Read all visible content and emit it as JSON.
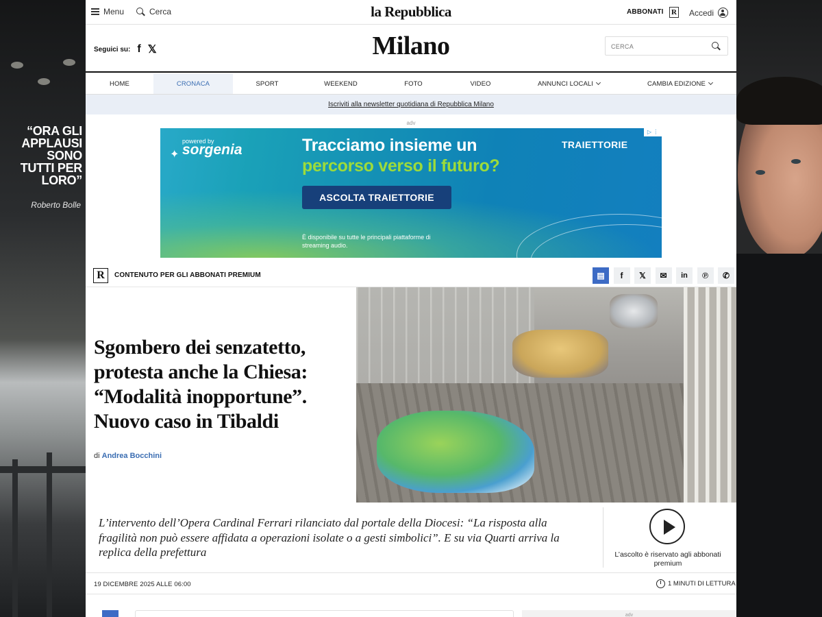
{
  "topbar": {
    "menu_label": "Menu",
    "search_label": "Cerca",
    "brand": "la Repubblica",
    "abbonati_label": "ABBONATI",
    "r_badge": "R",
    "accedi_label": "Accedi"
  },
  "masthead": {
    "follow_label": "Seguici su:",
    "facebook_glyph": "f",
    "x_glyph": "𝕏",
    "city": "Milano",
    "search_placeholder": "CERCA"
  },
  "nav": {
    "items": [
      {
        "label": "HOME",
        "active": false
      },
      {
        "label": "CRONACA",
        "active": true
      },
      {
        "label": "SPORT",
        "active": false
      },
      {
        "label": "WEEKEND",
        "active": false
      },
      {
        "label": "FOTO",
        "active": false
      },
      {
        "label": "VIDEO",
        "active": false
      },
      {
        "label": "ANNUNCI LOCALI",
        "active": false
      },
      {
        "label": "CAMBIA EDIZIONE",
        "active": false
      }
    ]
  },
  "newsletter": {
    "text": "Iscriviti alla newsletter quotidiana di Repubblica Milano"
  },
  "ad": {
    "label": "adv",
    "powered": "powered by",
    "brand": "sorgenia",
    "headline_1": "Tracciamo insieme un",
    "headline_2": "percorso verso il futuro?",
    "cta": "ASCOLTA TRAIETTORIE",
    "footnote": "È disponibile su tutte le principali piattaforme di streaming audio.",
    "sponsor": "TRAIETTORIE",
    "adchoices": "▷ ⋮"
  },
  "skin": {
    "quote": "“ORA GLI APPLAUSI SONO TUTTI PER LORO”",
    "signature": "Roberto Bolle"
  },
  "article": {
    "premium_badge": "R",
    "premium_label": "CONTENUTO PER GLI ABBONATI PREMIUM",
    "share_icons": [
      {
        "name": "comments-icon",
        "glyph": "▤"
      },
      {
        "name": "facebook-icon",
        "glyph": "f"
      },
      {
        "name": "x-icon",
        "glyph": "𝕏"
      },
      {
        "name": "email-icon",
        "glyph": "✉"
      },
      {
        "name": "linkedin-icon",
        "glyph": "in"
      },
      {
        "name": "pinterest-icon",
        "glyph": "℗"
      },
      {
        "name": "whatsapp-icon",
        "glyph": "✆"
      }
    ],
    "headline": "Sgombero dei senzatetto, protesta anche la Chiesa: “Modalità inopportune”. Nuovo caso in Tibaldi",
    "byline_prefix": "di",
    "author": "Andrea Bocchini",
    "summary": "L’intervento dell’Opera Cardinal Ferrari rilanciato dal portale della Diocesi: “La risposta alla fragilità non può essere affidata a operazioni isolate o a gesti simbolici”. E su via Quarti arriva la replica della prefettura",
    "audio_note": "L’ascolto è riservato agli abbonati premium",
    "date": "19 DICEMBRE 2025 ALLE 06:00",
    "reading_time": "1 MINUTI DI LETTURA"
  },
  "bottom": {
    "adv_label": "adv"
  },
  "colors": {
    "accent": "#3a6db2",
    "nav_active_bg": "#eef2f8",
    "newsletter_bg": "#e9eef6",
    "share_primary": "#3d6bc5"
  }
}
